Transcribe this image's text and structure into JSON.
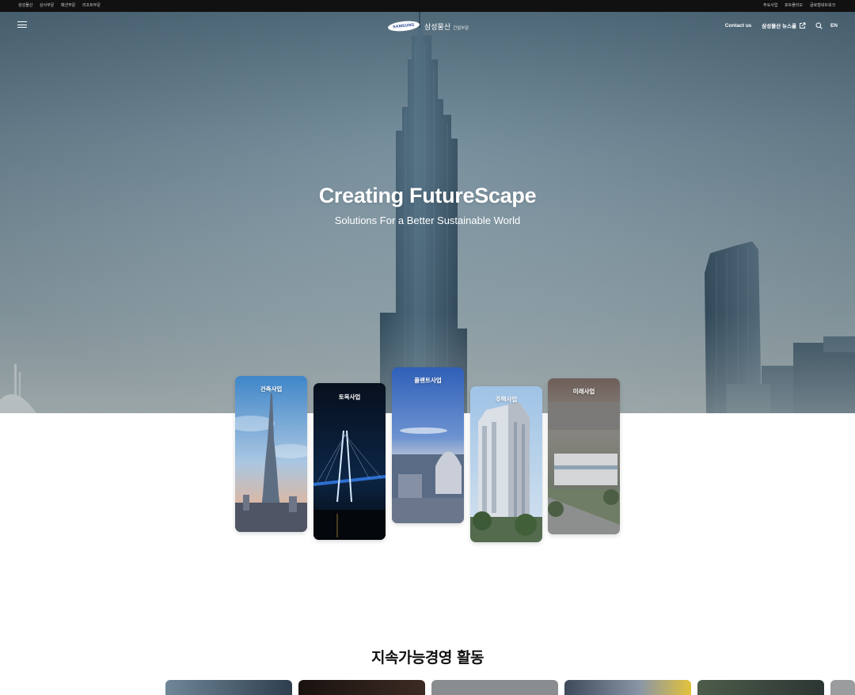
{
  "utility_bar": {
    "left_links": [
      "삼성물산",
      "상사부문",
      "패션부문",
      "리조트부문"
    ],
    "right_links": [
      "주요사업",
      "포트폴리오",
      "글로벌네트워크"
    ]
  },
  "header": {
    "menu_icon": "hamburger-menu-icon",
    "logo_mark": "SAMSUNG",
    "logo_brand": "삼성물산",
    "logo_sub": "건설부문",
    "contact_label": "Contact us",
    "newsroom_label": "삼성물산 뉴스룸",
    "newsroom_icon": "external-link-icon",
    "search_icon": "search-icon",
    "lang_label": "EN"
  },
  "hero": {
    "title": "Creating FutureScape",
    "subtitle": "Solutions For a Better Sustainable World"
  },
  "business_cards": [
    {
      "label": "건축사업"
    },
    {
      "label": "토목사업"
    },
    {
      "label": "플랜트사업"
    },
    {
      "label": "주택사업"
    },
    {
      "label": "미래사업"
    }
  ],
  "sustainability": {
    "title": "지속가능경영 활동"
  },
  "colors": {
    "utility_bar": "#111111",
    "sky_top": "#4f6a7b",
    "sky_bottom": "#a7b4b7",
    "text_white": "#ffffff"
  }
}
